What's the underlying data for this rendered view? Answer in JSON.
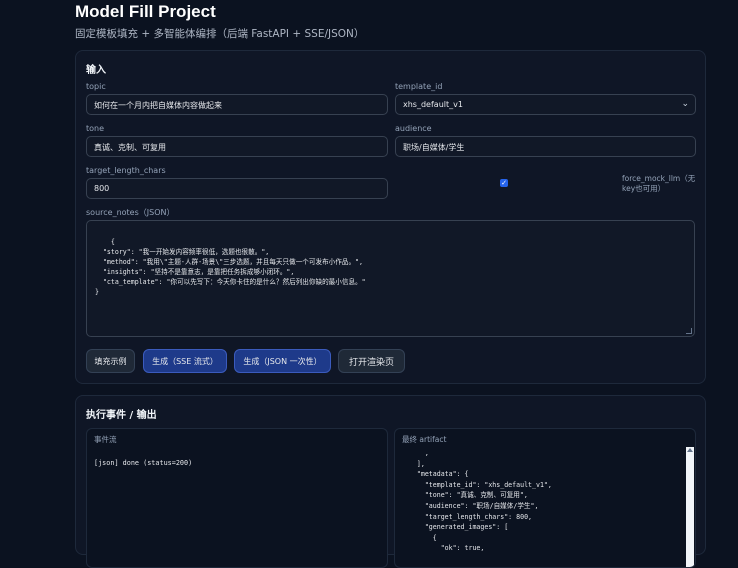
{
  "header": {
    "title": "Model Fill Project",
    "subtitle": "固定模板填充 + 多智能体编排（后端 FastAPI + SSE/JSON）"
  },
  "input_card": {
    "title": "输入",
    "topic_label": "topic",
    "topic_value": "如何在一个月内把自媒体内容做起来",
    "template_label": "template_id",
    "template_value": "xhs_default_v1",
    "tone_label": "tone",
    "tone_value": "真诚、克制、可复用",
    "audience_label": "audience",
    "audience_value": "职场/自媒体/学生",
    "length_label": "target_length_chars",
    "length_value": "800",
    "mock_label": "force_mock_llm（无key也可用）",
    "mock_checked": true,
    "notes_label": "source_notes（JSON）",
    "notes_value": "{\n  \"story\": \"我一开始发内容频率很低，选题也很散。\",\n  \"method\": \"我用\\\"主题-人群-场景\\\"三步选题，并且每天只做一个可发布小作品。\",\n  \"insights\": \"坚持不是靠意志，是靠把任务拆成够小闭环。\",\n  \"cta_template\": \"你可以先写下：今天你卡住的是什么？然后列出你缺的最小信息。\"\n}"
  },
  "buttons": {
    "fill_example": "填充示例",
    "generate_sse": "生成（SSE 流式）",
    "generate_json": "生成（JSON 一次性）",
    "open_render": "打开渲染页"
  },
  "output_card": {
    "title": "执行事件 / 输出",
    "events_label": "事件流",
    "event_line": "[json] done (status=200)",
    "artifact_label": "最终 artifact",
    "artifact_text": "      ,\n    ],\n    \"metadata\": {\n      \"template_id\": \"xhs_default_v1\",\n      \"tone\": \"真诚、克制、可复用\",\n      \"audience\": \"职场/自媒体/学生\",\n      \"target_length_chars\": 800,\n      \"generated_images\": [\n        {\n          \"ok\": true,"
  },
  "colors": {
    "background": "#0b1220",
    "card": "#0f1626",
    "primary_button": "#1e3a8a",
    "checkbox": "#2563eb"
  }
}
